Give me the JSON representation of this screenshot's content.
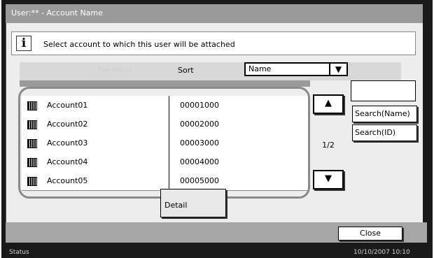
{
  "window": {
    "title": "User:** - Account Name"
  },
  "message": "Select account to which this user will be attached",
  "header": {
    "file_name_ghost": "File Name",
    "sort_label": "Sort",
    "sort_value": "Name"
  },
  "accounts": [
    {
      "name": "Account01",
      "id": "00001000"
    },
    {
      "name": "Account02",
      "id": "00002000"
    },
    {
      "name": "Account03",
      "id": "00003000"
    },
    {
      "name": "Account04",
      "id": "00004000"
    },
    {
      "name": "Account05",
      "id": "00005000"
    }
  ],
  "pager": {
    "page": "1/2"
  },
  "buttons": {
    "search_name": "Search(Name)",
    "search_id": "Search(ID)",
    "detail": "Detail",
    "close": "Close"
  },
  "status": {
    "label": "Status",
    "datetime": "10/10/2007   10:10"
  },
  "icons": {
    "info": "info-icon",
    "up": "triangle-up-icon",
    "down": "triangle-down-icon",
    "account": "account-icon"
  }
}
